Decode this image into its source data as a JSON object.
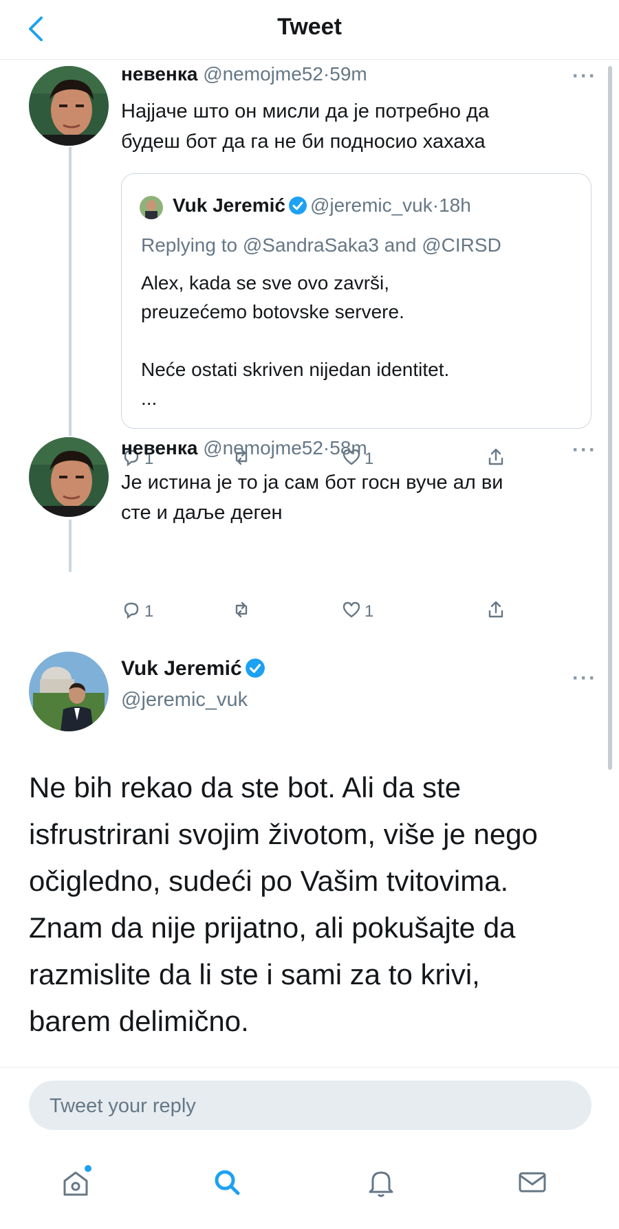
{
  "header": {
    "title": "Tweet"
  },
  "tweets": [
    {
      "name": "невенка",
      "handle": "@nemojme52",
      "time": "59m",
      "text_lines": [
        "Најјаче што он мисли да је потребно да",
        "будеш бот да га не би подносио хахаха"
      ],
      "quote": {
        "name": "Vuk Jeremić",
        "handle": "@jeremic_vuk",
        "time": "18h",
        "replying": "Replying to @SandraSaka3 and @CIRSD",
        "lines": [
          "Alex, kada se sve ovo završi,",
          "preuzećemo botovske servere.",
          "",
          "Neće ostati skriven nijedan identitet.",
          "..."
        ]
      },
      "replies": "1",
      "likes": "1"
    },
    {
      "name": "невенка",
      "handle": "@nemojme52",
      "time": "58m",
      "text_lines": [
        "Је истина је то ја сам бот госн вуче ал ви",
        "сте и даље деген"
      ],
      "replies": "1",
      "likes": "1"
    }
  ],
  "main_tweet": {
    "name": "Vuk Jeremić",
    "handle": "@jeremic_vuk",
    "text_lines": [
      "Ne bih rekao da ste bot. Ali da ste",
      "isfrustrirani svojim životom, više je nego",
      "očigledno, sudeći po Vašim tvitovima.",
      "Znam da nije prijatno, ali pokušajte da",
      "razmislite da li ste i sami za to krivi,",
      "barem delimično."
    ]
  },
  "reply": {
    "placeholder": "Tweet your reply"
  },
  "separator": "·",
  "more": "···",
  "colors": {
    "accent": "#1da1f2",
    "muted": "#657786",
    "border": "#e6ecf0"
  },
  "icons": [
    "back-chevron-icon",
    "more-icon",
    "verified-badge-icon",
    "reply-icon",
    "retweet-icon",
    "like-icon",
    "share-icon",
    "home-icon",
    "search-icon",
    "notifications-icon",
    "messages-icon"
  ],
  "tabs": [
    {
      "name": "home",
      "notification_dot": true
    },
    {
      "name": "search",
      "active": true
    },
    {
      "name": "notifications"
    },
    {
      "name": "messages"
    }
  ]
}
